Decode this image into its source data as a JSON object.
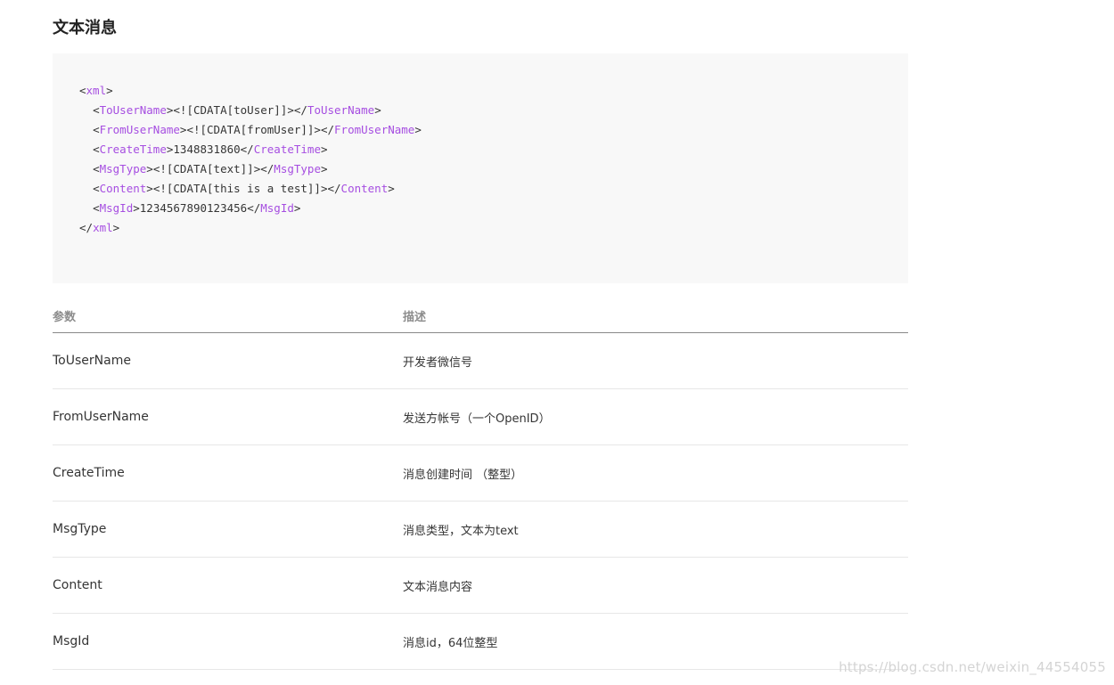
{
  "section_title": "文本消息",
  "code": {
    "lines": [
      {
        "indent": "",
        "open": "xml",
        "content": "",
        "close": ""
      },
      {
        "indent": "  ",
        "open": "ToUserName",
        "content": "<![CDATA[toUser]]>",
        "close": "ToUserName"
      },
      {
        "indent": "  ",
        "open": "FromUserName",
        "content": "<![CDATA[fromUser]]>",
        "close": "FromUserName"
      },
      {
        "indent": "  ",
        "open": "CreateTime",
        "content": "1348831860",
        "close": "CreateTime"
      },
      {
        "indent": "  ",
        "open": "MsgType",
        "content": "<![CDATA[text]]>",
        "close": "MsgType"
      },
      {
        "indent": "  ",
        "open": "Content",
        "content": "<![CDATA[this is a test]]>",
        "close": "Content"
      },
      {
        "indent": "  ",
        "open": "MsgId",
        "content": "1234567890123456",
        "close": "MsgId"
      },
      {
        "indent": "",
        "open": "",
        "content": "",
        "close": "xml"
      }
    ],
    "tag_color": "#a64ee1"
  },
  "table": {
    "headers": [
      "参数",
      "描述"
    ],
    "rows": [
      [
        "ToUserName",
        "开发者微信号"
      ],
      [
        "FromUserName",
        "发送方帐号（一个OpenID）"
      ],
      [
        "CreateTime",
        "消息创建时间 （整型）"
      ],
      [
        "MsgType",
        "消息类型，文本为text"
      ],
      [
        "Content",
        "文本消息内容"
      ],
      [
        "MsgId",
        "消息id，64位整型"
      ]
    ]
  },
  "watermark": "https://blog.csdn.net/weixin_44554055"
}
